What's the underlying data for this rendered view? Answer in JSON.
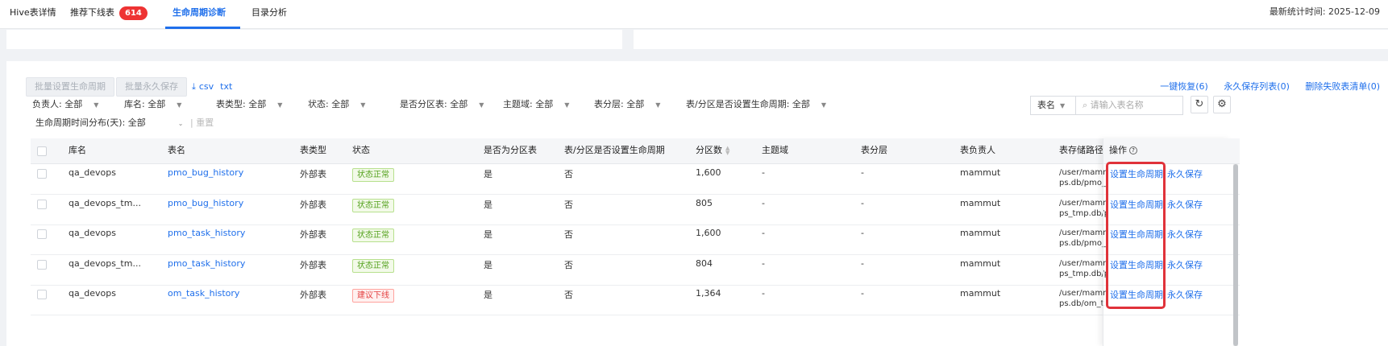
{
  "tabs": [
    {
      "label": "Hive表详情"
    },
    {
      "label": "推荐下线表",
      "badge": "614"
    },
    {
      "label": "生命周期诊断"
    },
    {
      "label": "目录分析"
    }
  ],
  "stat_time": "最新统计时间: 2025-12-09",
  "toolbar": {
    "batch_lifecycle": "批量设置生命周期",
    "batch_permanent": "批量永久保存",
    "export_csv": "csv",
    "export_txt": "txt"
  },
  "top_links": {
    "restore": "一键恢复(6)",
    "permanent_list": "永久保存列表(0)",
    "delete_failed": "删除失败表清单(0)"
  },
  "filters": [
    {
      "label": "负责人: 全部"
    },
    {
      "label": "库名: 全部"
    },
    {
      "label": "表类型: 全部"
    },
    {
      "label": "状态: 全部"
    },
    {
      "label": "是否分区表: 全部"
    },
    {
      "label": "主题域: 全部"
    },
    {
      "label": "表分层: 全部"
    },
    {
      "label": "表/分区是否设置生命周期: 全部"
    },
    {
      "label": "生命周期时间分布(天): 全部"
    }
  ],
  "reset_label": "重置",
  "search": {
    "select": "表名",
    "placeholder": "请输入表名称"
  },
  "columns": {
    "db": "库名",
    "table": "表名",
    "type": "表类型",
    "status": "状态",
    "partitioned": "是否为分区表",
    "lifecycle_set": "表/分区是否设置生命周期",
    "partitions": "分区数",
    "domain": "主题域",
    "layer": "表分层",
    "owner": "表负责人",
    "path": "表存储路径",
    "actions": "操作"
  },
  "rows": [
    {
      "db": "qa_devops",
      "table": "pmo_bug_history",
      "type": "外部表",
      "status": "状态正常",
      "status_kind": "ok",
      "partitioned": "是",
      "lifecycle_set": "否",
      "partitions": "1,600",
      "domain": "-",
      "layer": "-",
      "owner": "mammut",
      "path1": "/user/mamm",
      "path2": "ps.db/pmo_",
      "action1": "设置生命周期",
      "action2": "永久保存"
    },
    {
      "db": "qa_devops_tm...",
      "table": "pmo_bug_history",
      "type": "外部表",
      "status": "状态正常",
      "status_kind": "ok",
      "partitioned": "是",
      "lifecycle_set": "否",
      "partitions": "805",
      "domain": "-",
      "layer": "-",
      "owner": "mammut",
      "path1": "/user/mamm",
      "path2": "ps_tmp.db/p",
      "action1": "设置生命周期",
      "action2": "永久保存"
    },
    {
      "db": "qa_devops",
      "table": "pmo_task_history",
      "type": "外部表",
      "status": "状态正常",
      "status_kind": "ok",
      "partitioned": "是",
      "lifecycle_set": "否",
      "partitions": "1,600",
      "domain": "-",
      "layer": "-",
      "owner": "mammut",
      "path1": "/user/mamm",
      "path2": "ps.db/pmo_t",
      "action1": "设置生命周期",
      "action2": "永久保存"
    },
    {
      "db": "qa_devops_tm...",
      "table": "pmo_task_history",
      "type": "外部表",
      "status": "状态正常",
      "status_kind": "ok",
      "partitioned": "是",
      "lifecycle_set": "否",
      "partitions": "804",
      "domain": "-",
      "layer": "-",
      "owner": "mammut",
      "path1": "/user/mamm",
      "path2": "ps_tmp.db/p",
      "action1": "设置生命周期",
      "action2": "永久保存"
    },
    {
      "db": "qa_devops",
      "table": "om_task_history",
      "type": "外部表",
      "status": "建议下线",
      "status_kind": "warn",
      "partitioned": "是",
      "lifecycle_set": "否",
      "partitions": "1,364",
      "domain": "-",
      "layer": "-",
      "owner": "mammut",
      "path1": "/user/mamm",
      "path2": "ps.db/om_t",
      "action1": "设置生命周期",
      "action2": "永久保存"
    }
  ],
  "colors": {
    "accent": "#1f6feb",
    "highlight": "#e0323a",
    "badge": "#e33333"
  }
}
